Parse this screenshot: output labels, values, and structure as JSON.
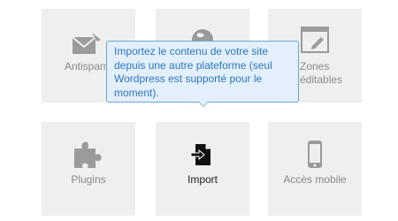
{
  "tiles": {
    "antispam": {
      "label": "Antispam",
      "icon": "envelope-icon"
    },
    "web": {
      "label": "",
      "icon": "globe-icon"
    },
    "zones": {
      "label_line1": "Zones",
      "label_line2": "éditables",
      "icon": "edit-window-icon"
    },
    "plugins": {
      "label": "Plugins",
      "icon": "puzzle-icon"
    },
    "import": {
      "label": "Import",
      "icon": "import-file-icon"
    },
    "mobile": {
      "label": "Accès mobile",
      "icon": "mobile-phone-icon"
    }
  },
  "tooltip": {
    "line1": "Importez le contenu de votre site",
    "line2": "depuis une autre plateforme (seul",
    "line3": "Wordpress est supporté pour le",
    "line4": "moment)."
  },
  "colors": {
    "tile_bg": "#efefef",
    "icon_gray": "#9b9b9b",
    "tooltip_bg": "#e3f0fb",
    "tooltip_border": "#6aa6d8",
    "tooltip_text": "#2c74c0"
  }
}
